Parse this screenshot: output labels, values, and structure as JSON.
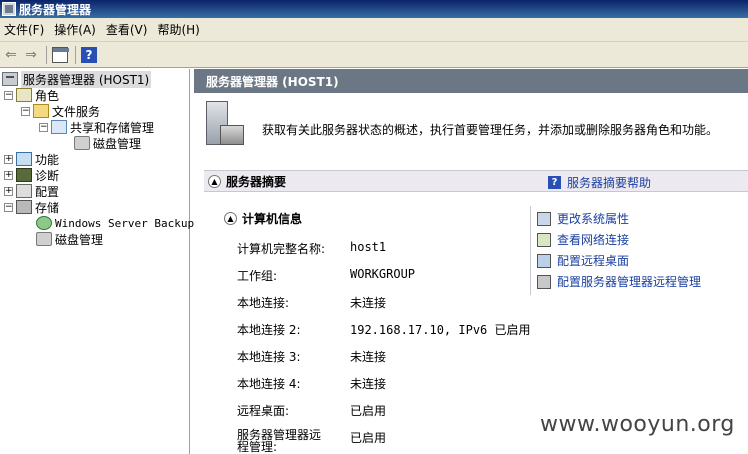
{
  "window": {
    "title": "服务器管理器"
  },
  "menu": [
    "文件(F)",
    "操作(A)",
    "查看(V)",
    "帮助(H)"
  ],
  "tree": {
    "root": "服务器管理器 (HOST1)",
    "roles": "角色",
    "file_services": "文件服务",
    "share_storage": "共享和存储管理",
    "disk_mgmt_1": "磁盘管理",
    "features": "功能",
    "diagnostics": "诊断",
    "configuration": "配置",
    "storage": "存储",
    "backup": "Windows Server Backup",
    "disk_mgmt_2": "磁盘管理"
  },
  "main": {
    "header": "服务器管理器 (HOST1)",
    "intro": "获取有关此服务器状态的概述，执行首要管理任务，并添加或删除服务器角色和功能。",
    "summary_title": "服务器摘要",
    "summary_help": "服务器摘要帮助",
    "computer_info_title": "计算机信息",
    "fields": [
      {
        "label": "计算机完整名称:",
        "value": "host1"
      },
      {
        "label": "工作组:",
        "value": "WORKGROUP"
      },
      {
        "label": "本地连接:",
        "value": "未连接"
      },
      {
        "label": "本地连接 2:",
        "value": "192.168.17.10, IPv6 已启用"
      },
      {
        "label": "本地连接 3:",
        "value": "未连接"
      },
      {
        "label": "本地连接 4:",
        "value": "未连接"
      },
      {
        "label": "远程桌面:",
        "value": "已启用"
      },
      {
        "label": "服务器管理器远程管理:",
        "value": "已启用"
      }
    ],
    "tasks": [
      "更改系统属性",
      "查看网络连接",
      "配置远程桌面",
      "配置服务器管理器远程管理"
    ]
  },
  "watermark": "www.wooyun.org"
}
